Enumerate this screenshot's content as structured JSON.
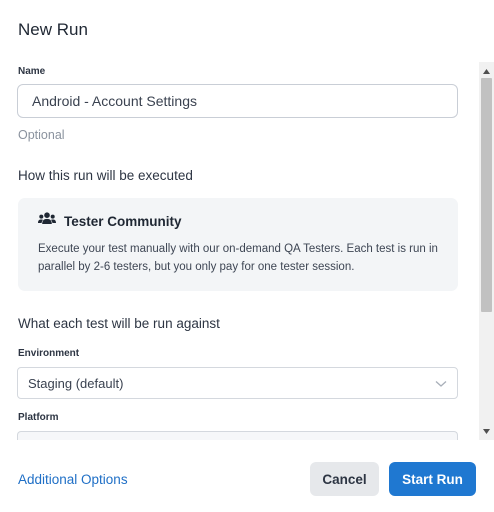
{
  "dialog": {
    "title": "New Run"
  },
  "name_field": {
    "label": "Name",
    "value": "Android - Account Settings",
    "hint": "Optional"
  },
  "execution": {
    "heading": "How this run will be executed",
    "option_icon": "users-icon",
    "option_title": "Tester Community",
    "option_description": "Execute your test manually with our on-demand QA Testers. Each test is run in parallel by 2-6 testers, but you only pay for one tester session."
  },
  "target": {
    "heading": "What each test will be run against",
    "environment_label": "Environment",
    "environment_value": "Staging (default)",
    "platform_label": "Platform",
    "platform_value": ""
  },
  "footer": {
    "additional_options": "Additional Options",
    "cancel": "Cancel",
    "start_run": "Start Run"
  },
  "colors": {
    "primary": "#1f78d1",
    "link": "#1f6fc6",
    "card_bg": "#f3f5f7"
  }
}
